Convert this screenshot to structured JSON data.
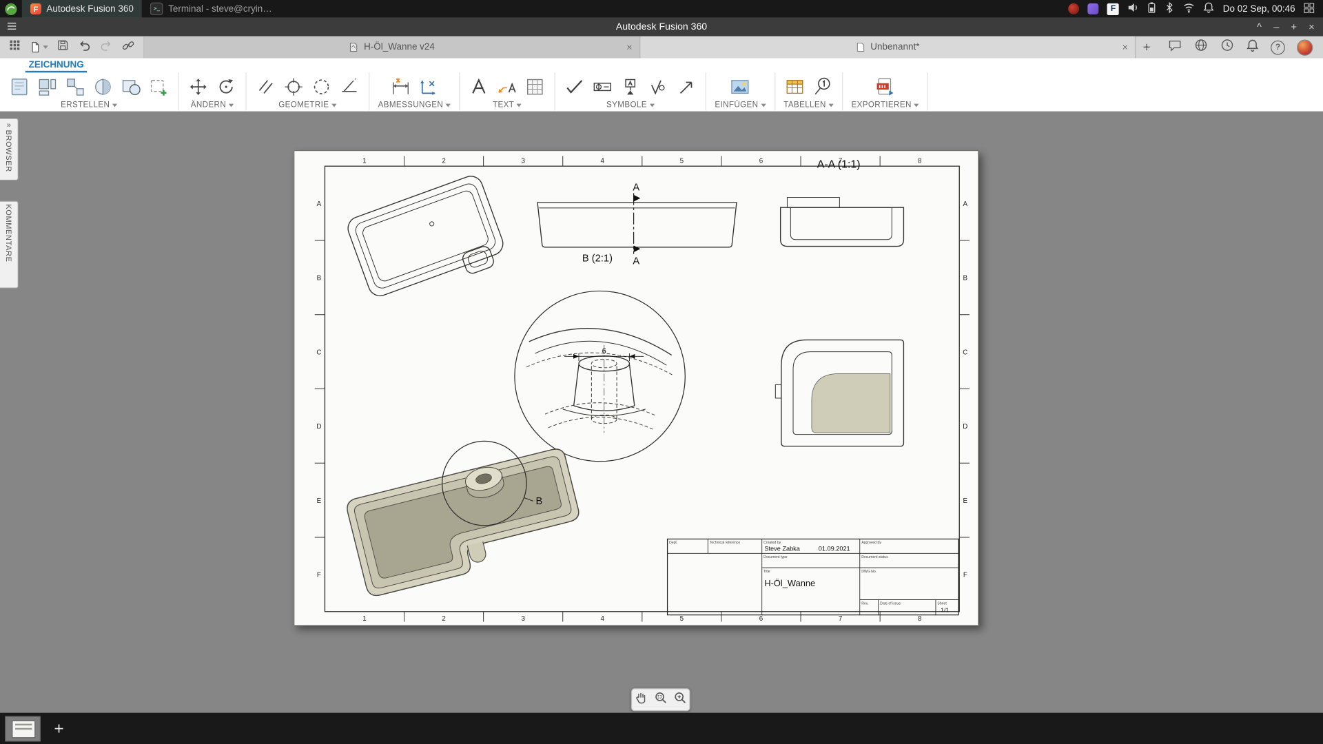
{
  "os_taskbar": {
    "windows": [
      {
        "title": "Autodesk Fusion 360"
      },
      {
        "title": "Terminal - steve@cryin…"
      }
    ],
    "clock": "Do 02 Sep, 00:46"
  },
  "titlebar": {
    "title": "Autodesk Fusion 360",
    "window_controls": [
      "^",
      "–",
      "+",
      "×"
    ]
  },
  "glyphs": {
    "close": "×",
    "plus": "+",
    "help": "?",
    "fusion_initial": "F",
    "terminal_prompt": ">_",
    "chevron_expand": "»"
  },
  "tabbar": {
    "tabs": [
      {
        "label": "H-Öl_Wanne v24"
      },
      {
        "label": "Unbenannt*"
      }
    ]
  },
  "ribbon": {
    "workspace_tab": "ZEICHNUNG",
    "groups": [
      {
        "label": "ERSTELLEN",
        "icons": [
          "sheet-icon",
          "base-view-icon",
          "projected-view-icon",
          "section-view-icon",
          "detail-view-icon",
          "sketch-icon"
        ]
      },
      {
        "label": "ÄNDERN",
        "icons": [
          "move-icon",
          "rotate-icon"
        ]
      },
      {
        "label": "GEOMETRIE",
        "icons": [
          "centerline-icon",
          "center-mark-icon",
          "circle-icon",
          "extend-icon"
        ]
      },
      {
        "label": "ABMESSUNGEN",
        "icons": [
          "dimension-icon",
          "ordinate-dimension-icon"
        ]
      },
      {
        "label": "TEXT",
        "icons": [
          "text-icon",
          "leader-text-icon",
          "symbol-table-icon"
        ]
      },
      {
        "label": "SYMBOLE",
        "icons": [
          "surface-check-icon",
          "tolerance-frame-icon",
          "datum-icon",
          "surface-finish-icon",
          "edge-symbol-icon"
        ]
      },
      {
        "label": "EINFÜGEN",
        "icons": [
          "image-icon"
        ]
      },
      {
        "label": "TABELLEN",
        "icons": [
          "table-icon",
          "balloon-icon"
        ]
      },
      {
        "label": "EXPORTIEREN",
        "icons": [
          "pdf-export-icon"
        ]
      }
    ]
  },
  "side_panels": {
    "browser": "BROWSER",
    "comments": "KOMMENTARE"
  },
  "icons": {
    "quick_access": [
      "app-grid-icon",
      "file-menu-icon",
      "save-icon",
      "undo-icon",
      "redo-icon",
      "share-link-icon"
    ],
    "tab_right": [
      "comment-icon",
      "online-status-icon",
      "history-icon",
      "notifications-icon",
      "help-icon",
      "avatar"
    ],
    "nav_toolbar": [
      "pan-hand-icon",
      "zoom-window-icon",
      "zoom-icon"
    ],
    "tray": [
      "volume-icon",
      "battery-icon",
      "bluetooth-icon",
      "wifi-icon",
      "bell-icon",
      "panel-grid-icon"
    ]
  },
  "drawing": {
    "labels": {
      "section_view": "A-A (1:1)",
      "detail_view": "B (2:1)",
      "cut_top": "A",
      "cut_bottom": "A",
      "detail_marker": "B",
      "dim_boss": "6"
    },
    "border": {
      "cols": [
        "1",
        "2",
        "3",
        "4",
        "5",
        "6",
        "7",
        "8"
      ],
      "rows": [
        "A",
        "B",
        "C",
        "D",
        "E",
        "F"
      ]
    },
    "titleblock": {
      "dept_label": "Dept.",
      "tech_ref_label": "Technical reference",
      "created_label": "Created by",
      "approved_label": "Approved by",
      "created_by": "Steve Zabka",
      "date": "01.09.2021",
      "doc_type_label": "Document type",
      "doc_status_label": "Document status",
      "title_label": "Title",
      "dwg_label": "DWG No.",
      "title": "H-Öl_Wanne",
      "rev_label": "Rev.",
      "issue_label": "Date of issue",
      "sheet_label": "Sheet",
      "sheet": "1/1"
    }
  }
}
